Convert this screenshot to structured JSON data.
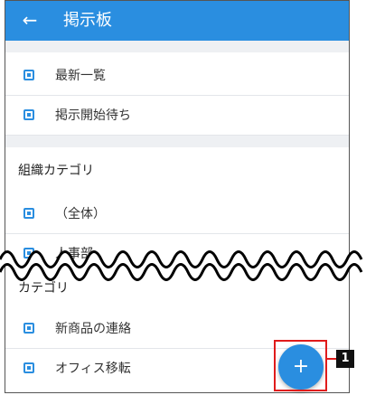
{
  "app_bar": {
    "back_icon": "arrow-left-icon",
    "title": "掲示板"
  },
  "list_a": [
    {
      "label": "最新一覧",
      "icon": "square-bullet-icon"
    },
    {
      "label": "掲示開始待ち",
      "icon": "square-bullet-icon"
    }
  ],
  "section_org": {
    "heading": "組織カテゴリ",
    "items": [
      {
        "label": "（全体）",
        "icon": "square-bullet-icon"
      },
      {
        "label": "人事部",
        "icon": "square-bullet-icon"
      }
    ]
  },
  "section_cat": {
    "heading": "カテゴリ",
    "items": [
      {
        "label": "新商品の連絡",
        "icon": "square-bullet-icon"
      },
      {
        "label": "オフィス移転",
        "icon": "square-bullet-icon"
      }
    ]
  },
  "fab": {
    "glyph": "+",
    "icon": "plus-icon"
  },
  "callout": {
    "label": "1"
  },
  "colors": {
    "primary": "#2a8ee0",
    "annotation": "#e01b1b",
    "divider": "#e3e6ea",
    "section_bg": "#eef0f3"
  }
}
